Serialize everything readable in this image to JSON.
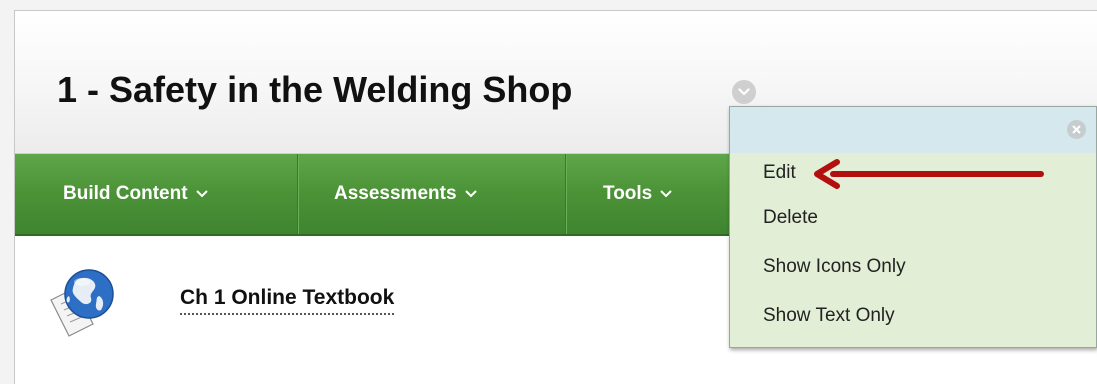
{
  "page": {
    "title": "1 - Safety in the Welding Shop"
  },
  "nav": {
    "items": [
      {
        "label": "Build Content"
      },
      {
        "label": "Assessments"
      },
      {
        "label": "Tools"
      }
    ]
  },
  "content": {
    "items": [
      {
        "label": "Ch 1 Online Textbook",
        "icon": "globe-document-icon"
      }
    ]
  },
  "dropdown": {
    "items": [
      {
        "label": "Edit"
      },
      {
        "label": "Delete"
      },
      {
        "label": "Show Icons Only"
      },
      {
        "label": "Show Text Only"
      }
    ]
  },
  "colors": {
    "nav_bar": "#4b9237",
    "dropdown_bg": "#e2efd6",
    "dropdown_header": "#d5e8ee",
    "annotation_arrow": "#b30f0f"
  }
}
